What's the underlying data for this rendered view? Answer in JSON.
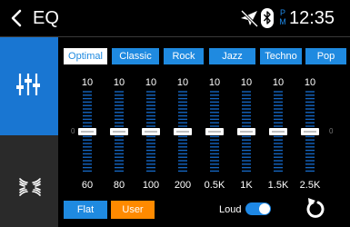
{
  "header": {
    "title": "EQ",
    "clock": "12:35",
    "ampm_top": "P",
    "ampm_bottom": "M"
  },
  "icons": {
    "back": "chevron-left-icon",
    "no_navigation": "navigation-off-icon",
    "bluetooth": "bluetooth-icon",
    "equalizer": "equalizer-sliders-icon",
    "surround": "surround-sound-icon",
    "reset": "reset-icon"
  },
  "presets": [
    {
      "label": "Optimal",
      "active": true
    },
    {
      "label": "Classic",
      "active": false
    },
    {
      "label": "Rock",
      "active": false
    },
    {
      "label": "Jazz",
      "active": false
    },
    {
      "label": "Techno",
      "active": false
    },
    {
      "label": "Pop",
      "active": false
    }
  ],
  "bands": [
    {
      "freq": "60",
      "value": "10"
    },
    {
      "freq": "80",
      "value": "10"
    },
    {
      "freq": "100",
      "value": "10"
    },
    {
      "freq": "200",
      "value": "10"
    },
    {
      "freq": "0.5K",
      "value": "10"
    },
    {
      "freq": "1K",
      "value": "10"
    },
    {
      "freq": "1.5K",
      "value": "10"
    },
    {
      "freq": "2.5K",
      "value": "10"
    }
  ],
  "zero_label": "0",
  "buttons": {
    "flat": "Flat",
    "user": "User"
  },
  "loud": {
    "label": "Loud",
    "on": true
  },
  "colors": {
    "accent": "#1f8ae0",
    "user": "#ff8a00",
    "sidebar": "#2a2a2a"
  }
}
